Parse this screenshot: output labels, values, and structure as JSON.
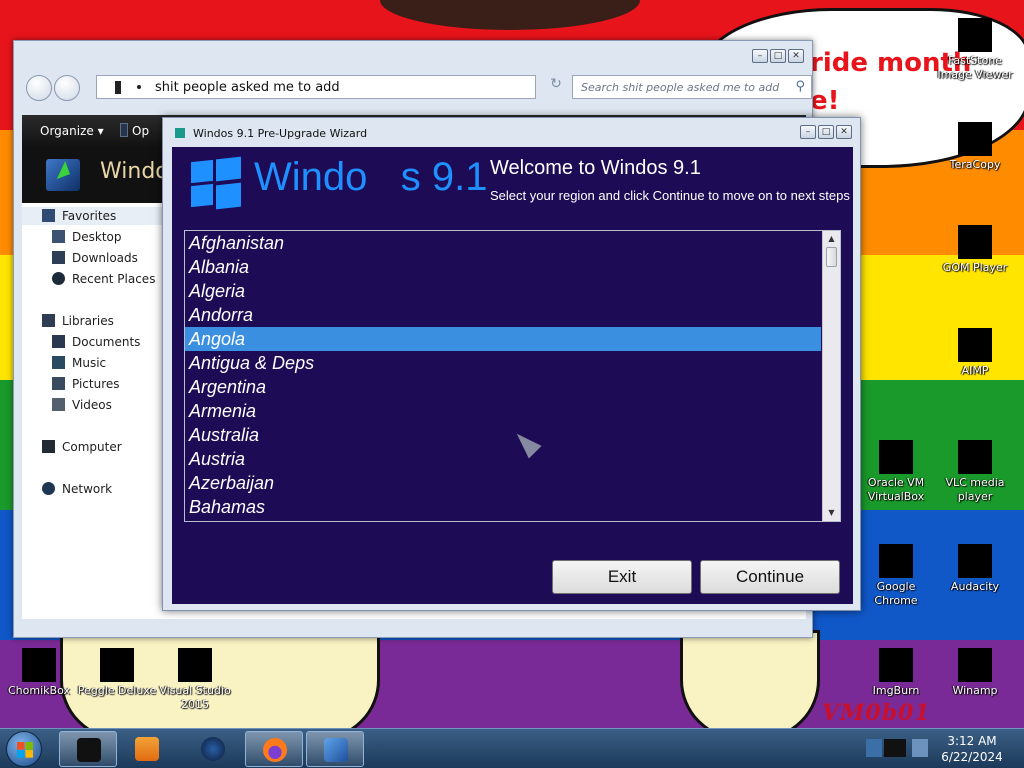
{
  "explorer": {
    "address_path": "shit people asked me to add",
    "search_placeholder": "Search shit people asked me to add",
    "organize_label": "Organize ▾",
    "toolbar_partial": "Op",
    "header_title": "Windo",
    "nav": {
      "favorites": "Favorites",
      "desktop": "Desktop",
      "downloads": "Downloads",
      "recent_places": "Recent Places",
      "libraries": "Libraries",
      "documents": "Documents",
      "music": "Music",
      "pictures": "Pictures",
      "videos": "Videos",
      "computer": "Computer",
      "network": "Network"
    }
  },
  "wizard": {
    "window_title": "Windos 9.1 Pre-Upgrade Wizard",
    "logo_text": "Windo   s 9.1",
    "heading": "Welcome to Windos 9.1",
    "subheading": "Select your region and click Continue to move on to next steps",
    "regions": [
      "Afghanistan",
      "Albania",
      "Algeria",
      "Andorra",
      "Angola",
      "Antigua & Deps",
      "Argentina",
      "Armenia",
      "Australia",
      "Austria",
      "Azerbaijan",
      "Bahamas"
    ],
    "selected_region": "Angola",
    "exit_label": "Exit",
    "continue_label": "Continue"
  },
  "desktop": {
    "banner_text": "ride month\ne!",
    "signature": "VM0b01",
    "icons": {
      "faststone": "FastStone\nImage Viewer",
      "teracopy": "TeraCopy",
      "gom": "GOM Player",
      "aimp": "AIMP",
      "virtualbox": "Oracle VM\nVirtualBox",
      "vlc": "VLC media\nplayer",
      "chrome": "Google\nChrome",
      "audacity": "Audacity",
      "imgburn": "ImgBurn",
      "winamp": "Winamp",
      "chomikbox": "ChomikBox",
      "peggle": "Peggle Deluxe",
      "visualstudio": "Visual Studio\n2015"
    }
  },
  "taskbar": {
    "time": "3:12 AM",
    "date": "6/22/2024"
  },
  "colors": {
    "wizard_background": "#1e0b55",
    "selection": "#3b8fe0",
    "logo_blue": "#1e90ff",
    "stripes": [
      "#e8141b",
      "#ff8c00",
      "#ffe500",
      "#1a9a2a",
      "#1057c8",
      "#7a2a96"
    ]
  }
}
